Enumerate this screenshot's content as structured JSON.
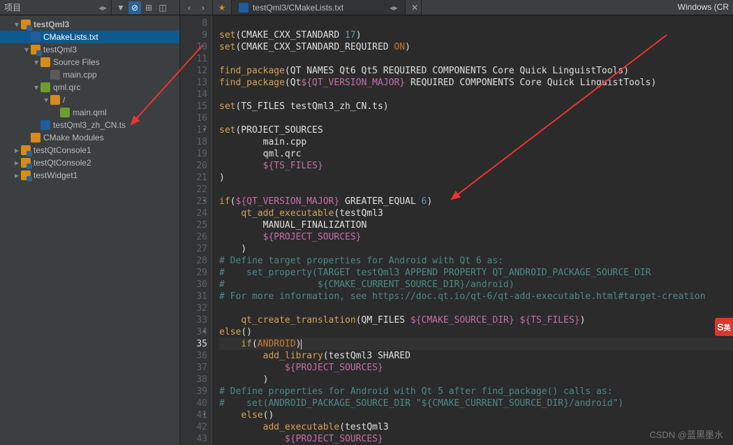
{
  "panel": {
    "title": "项目"
  },
  "tab": {
    "path": "testQml3/CMakeLists.txt"
  },
  "kit": "Windows (CR",
  "watermark": "CSDN @蓝黑墨水",
  "tree": [
    {
      "d": 1,
      "exp": "▾",
      "icon": "i-proj",
      "label": "testQml3",
      "sel": false,
      "bold": true
    },
    {
      "d": 2,
      "exp": "",
      "icon": "i-cmake",
      "label": "CMakeLists.txt",
      "sel": true
    },
    {
      "d": 2,
      "exp": "▾",
      "icon": "i-proj",
      "label": "testQml3"
    },
    {
      "d": 3,
      "exp": "▾",
      "icon": "i-folder",
      "label": "Source Files"
    },
    {
      "d": 4,
      "exp": "",
      "icon": "i-cpp",
      "label": "main.cpp"
    },
    {
      "d": 3,
      "exp": "▾",
      "icon": "i-qrc",
      "label": "qml.qrc"
    },
    {
      "d": 4,
      "exp": "▾",
      "icon": "i-folder",
      "label": "/"
    },
    {
      "d": 5,
      "exp": "",
      "icon": "i-qml",
      "label": "main.qml"
    },
    {
      "d": 3,
      "exp": "",
      "icon": "i-ts",
      "label": "testQml3_zh_CN.ts"
    },
    {
      "d": 2,
      "exp": "",
      "icon": "i-folder",
      "label": "CMake Modules"
    },
    {
      "d": 1,
      "exp": "▸",
      "icon": "i-proj",
      "label": "testQtConsole1"
    },
    {
      "d": 1,
      "exp": "▸",
      "icon": "i-proj",
      "label": "testQtConsole2"
    },
    {
      "d": 1,
      "exp": "▸",
      "icon": "i-proj",
      "label": "testWidget1"
    }
  ],
  "code": {
    "start": 8,
    "current": 35,
    "folds": [
      17,
      23,
      34,
      35,
      41
    ],
    "lines": [
      [],
      [
        [
          "kw",
          "set"
        ],
        [
          "plain",
          "(CMAKE_CXX_STANDARD "
        ],
        [
          "num",
          "17"
        ],
        [
          "plain",
          ")"
        ]
      ],
      [
        [
          "kw",
          "set"
        ],
        [
          "plain",
          "(CMAKE_CXX_STANDARD_REQUIRED "
        ],
        [
          "pn",
          "ON"
        ],
        [
          "plain",
          ")"
        ]
      ],
      [],
      [
        [
          "kw",
          "find_package"
        ],
        [
          "plain",
          "(QT NAMES Qt6 Qt5 REQUIRED COMPONENTS Core Quick LinguistTools)"
        ]
      ],
      [
        [
          "kw",
          "find_package"
        ],
        [
          "plain",
          "(Qt"
        ],
        [
          "var",
          "${QT_VERSION_MAJOR}"
        ],
        [
          "plain",
          " REQUIRED COMPONENTS Core Quick LinguistTools)"
        ]
      ],
      [],
      [
        [
          "kw",
          "set"
        ],
        [
          "plain",
          "(TS_FILES testQml3_zh_CN.ts)"
        ]
      ],
      [],
      [
        [
          "kw",
          "set"
        ],
        [
          "plain",
          "(PROJECT_SOURCES"
        ]
      ],
      [
        [
          "plain",
          "        main.cpp"
        ]
      ],
      [
        [
          "plain",
          "        qml.qrc"
        ]
      ],
      [
        [
          "plain",
          "        "
        ],
        [
          "var",
          "${TS_FILES}"
        ]
      ],
      [
        [
          "plain",
          ")"
        ]
      ],
      [],
      [
        [
          "kw",
          "if"
        ],
        [
          "plain",
          "("
        ],
        [
          "var",
          "${QT_VERSION_MAJOR}"
        ],
        [
          "plain",
          " GREATER_EQUAL "
        ],
        [
          "num",
          "6"
        ],
        [
          "plain",
          ")"
        ]
      ],
      [
        [
          "plain",
          "    "
        ],
        [
          "kw",
          "qt_add_executable"
        ],
        [
          "plain",
          "(testQml3"
        ]
      ],
      [
        [
          "plain",
          "        MANUAL_FINALIZATION"
        ]
      ],
      [
        [
          "plain",
          "        "
        ],
        [
          "var",
          "${PROJECT_SOURCES}"
        ]
      ],
      [
        [
          "plain",
          "    )"
        ]
      ],
      [
        [
          "cm",
          "# Define target properties for Android with Qt 6 as:"
        ]
      ],
      [
        [
          "cm",
          "#    set_property(TARGET testQml3 APPEND PROPERTY QT_ANDROID_PACKAGE_SOURCE_DIR"
        ]
      ],
      [
        [
          "cm",
          "#                 ${CMAKE_CURRENT_SOURCE_DIR}/android)"
        ]
      ],
      [
        [
          "cm",
          "# For more information, see "
        ],
        [
          "url",
          "https://doc.qt.io/qt-6/qt-add-executable.html#target-creation"
        ]
      ],
      [],
      [
        [
          "plain",
          "    "
        ],
        [
          "kw",
          "qt_create_translation"
        ],
        [
          "plain",
          "(QM_FILES "
        ],
        [
          "var",
          "${CMAKE_SOURCE_DIR}"
        ],
        [
          "plain",
          " "
        ],
        [
          "var",
          "${TS_FILES}"
        ],
        [
          "plain",
          ")"
        ]
      ],
      [
        [
          "kw",
          "else"
        ],
        [
          "plain",
          "()"
        ]
      ],
      [
        [
          "plain",
          "    "
        ],
        [
          "kw",
          "if"
        ],
        [
          "plain",
          "("
        ],
        [
          "pn",
          "ANDROID"
        ],
        [
          "plain",
          ")"
        ],
        [
          "caret",
          ""
        ]
      ],
      [
        [
          "plain",
          "        "
        ],
        [
          "kw",
          "add_library"
        ],
        [
          "plain",
          "(testQml3 SHARED"
        ]
      ],
      [
        [
          "plain",
          "            "
        ],
        [
          "var",
          "${PROJECT_SOURCES}"
        ]
      ],
      [
        [
          "plain",
          "        )"
        ]
      ],
      [
        [
          "cm",
          "# Define properties for Android with Qt 5 after find_package() calls as:"
        ]
      ],
      [
        [
          "cm",
          "#    set(ANDROID_PACKAGE_SOURCE_DIR \"${CMAKE_CURRENT_SOURCE_DIR}/android\")"
        ]
      ],
      [
        [
          "plain",
          "    "
        ],
        [
          "kw",
          "else"
        ],
        [
          "plain",
          "()"
        ]
      ],
      [
        [
          "plain",
          "        "
        ],
        [
          "kw",
          "add_executable"
        ],
        [
          "plain",
          "(testQml3"
        ]
      ],
      [
        [
          "plain",
          "            "
        ],
        [
          "var",
          "${PROJECT_SOURCES}"
        ]
      ]
    ]
  }
}
